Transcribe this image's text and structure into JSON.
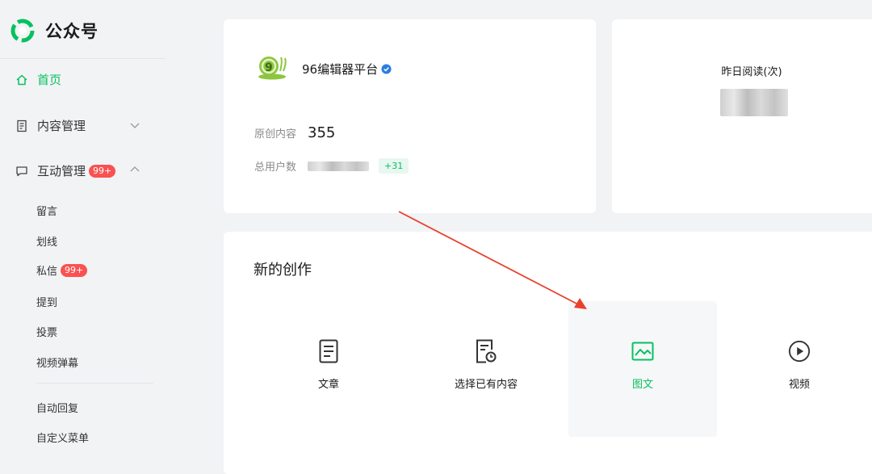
{
  "app": {
    "title": "公众号"
  },
  "sidebar": {
    "home": "首页",
    "content_mgmt": "内容管理",
    "interaction_mgmt": "互动管理",
    "interaction_badge": "99+",
    "sub_items": [
      "留言",
      "划线",
      "私信",
      "提到",
      "投票",
      "视频弹幕"
    ],
    "dm_badge": "99+",
    "auto_reply": "自动回复",
    "custom_menu": "自定义菜单"
  },
  "account": {
    "name": "96编辑器平台",
    "original_label": "原创内容",
    "original_value": "355",
    "users_label": "总用户数",
    "users_growth": "+31"
  },
  "stats": {
    "yesterday_reads_label": "昨日阅读(次)"
  },
  "create": {
    "title": "新的创作",
    "options": [
      {
        "label": "文章",
        "icon": "article-icon"
      },
      {
        "label": "选择已有内容",
        "icon": "existing-content-icon"
      },
      {
        "label": "图文",
        "icon": "image-text-icon"
      },
      {
        "label": "视频",
        "icon": "video-play-icon"
      }
    ]
  },
  "colors": {
    "brand_green": "#07c160",
    "badge_red": "#fa5151",
    "arrow_red": "#e8412c"
  }
}
